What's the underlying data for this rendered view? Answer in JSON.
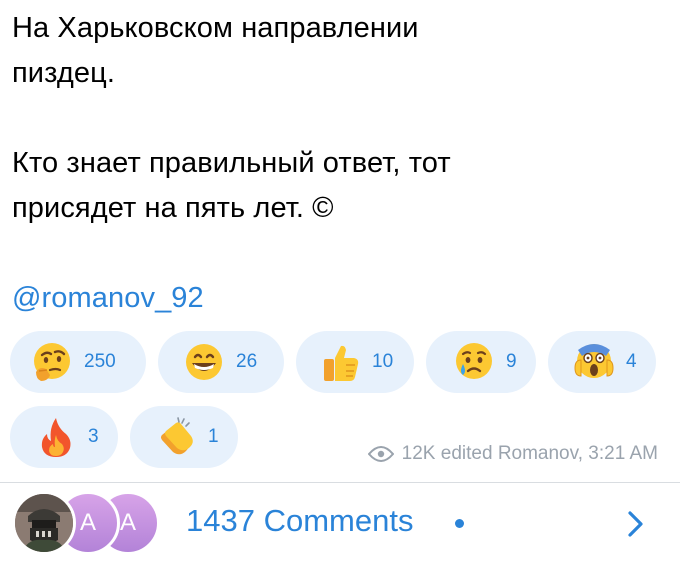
{
  "message": {
    "lines": [
      "На Харьковском направлении",
      "пиздец.",
      "Кто знает правильный ответ, тот",
      "присядет на пять лет. ©"
    ],
    "mention": "@romanov_92"
  },
  "reactions": [
    {
      "emoji_icon": "thinking-face-icon",
      "count": "250"
    },
    {
      "emoji_icon": "grinning-face-icon",
      "count": "26"
    },
    {
      "emoji_icon": "thumbs-up-icon",
      "count": "10"
    },
    {
      "emoji_icon": "crying-face-icon",
      "count": "9"
    },
    {
      "emoji_icon": "screaming-face-icon",
      "count": "4"
    },
    {
      "emoji_icon": "fire-icon",
      "count": "3"
    },
    {
      "emoji_icon": "clapping-hands-icon",
      "count": "1"
    }
  ],
  "meta": {
    "views": "12K",
    "edited": "edited",
    "author": "Romanov,",
    "time": "3:21 AM"
  },
  "comments": {
    "label": "1437 Comments",
    "avatars": [
      {
        "type": "photo"
      },
      {
        "letter": "A",
        "color": "#c596e0"
      },
      {
        "letter": "A",
        "color": "#c596e0"
      }
    ]
  },
  "colors": {
    "accent": "#2a83d8",
    "reaction_bg": "#e7f1fc",
    "meta": "#9aa3ad"
  }
}
